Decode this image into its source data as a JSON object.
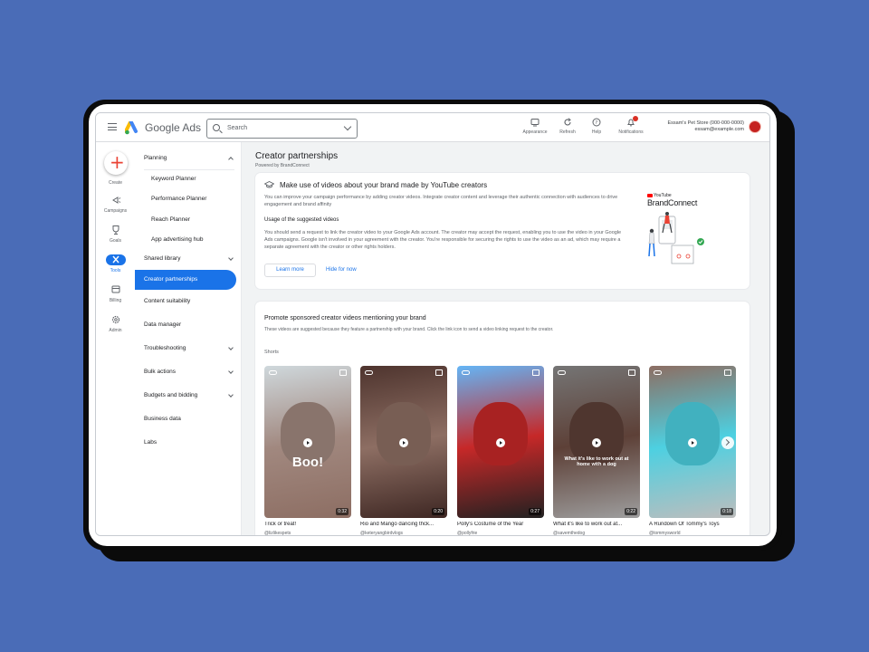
{
  "app": {
    "brand": "Google Ads",
    "search_placeholder": "Search",
    "accent_color": "#1a73e8",
    "background_color": "#4a6cb7"
  },
  "toolbar": {
    "actions": [
      {
        "label": "Appearance",
        "icon": "appearance-icon"
      },
      {
        "label": "Refresh",
        "icon": "refresh-icon"
      },
      {
        "label": "Help",
        "icon": "help-icon"
      },
      {
        "label": "Notifications",
        "icon": "bell-icon"
      }
    ],
    "account_name": "Essam's Pet Store (000-000-0000)",
    "account_email": "essam@example.com"
  },
  "rail": {
    "create_label": "Create",
    "items": [
      {
        "label": "Campaigns",
        "icon": "campaigns-icon"
      },
      {
        "label": "Goals",
        "icon": "trophy-icon"
      },
      {
        "label": "Tools",
        "icon": "tools-icon",
        "active": true
      },
      {
        "label": "Billing",
        "icon": "card-icon"
      },
      {
        "label": "Admin",
        "icon": "gear-icon"
      }
    ]
  },
  "nav": {
    "planning": "Planning",
    "keyword_planner": "Keyword Planner",
    "performance_planner": "Performance Planner",
    "reach_planner": "Reach Planner",
    "app_hub": "App advertising hub",
    "shared_library": "Shared library",
    "creator_partnerships": "Creator partnerships",
    "content_suitability": "Content suitability",
    "data_manager": "Data manager",
    "troubleshooting": "Troubleshooting",
    "bulk_actions": "Bulk actions",
    "budgets_bidding": "Budgets and bidding",
    "business_data": "Business data",
    "labs": "Labs"
  },
  "page": {
    "title": "Creator partnerships",
    "subtitle": "Powered by BrandConnect"
  },
  "intro_card": {
    "title": "Make use of videos about your brand made by YouTube creators",
    "body": "You can improve your campaign performance by adding creator videos. Integrate creator content and leverage their authentic connection with audiences to drive engagement and brand affinity",
    "usage_heading": "Usage of the suggested videos",
    "usage_body": "You should send a request to link the creator video to your Google Ads account. The creator may accept the request, enabling you to use the video in your Google Ads campaigns. Google isn't involved in your agreement with the creator. You're responsible for securing the rights to use the video as an ad, which may require a separate agreement with the creator or other rights holders.",
    "learn_more": "Learn more",
    "hide": "Hide for now",
    "logo_top": "YouTube",
    "logo_name": "BrandConnect"
  },
  "videos_card": {
    "title": "Promote sponsored creator videos mentioning your brand",
    "body": "These videos are suggested because they feature a partnership with your brand. Click the link icon to send a video linking request to the creator.",
    "section": "Shorts",
    "videos": [
      {
        "title": "Trick or treat!",
        "channel": "@lizlikespets",
        "duration": "0:32",
        "overlay": "Boo!",
        "colors": [
          "#cfd8dc",
          "#a1887f",
          "#8d6e63"
        ]
      },
      {
        "title": "Rio and Mango dancing thck...",
        "channel": "@keteryangbirdvlogs",
        "duration": "0:20",
        "overlay": "",
        "colors": [
          "#4e342e",
          "#8d6e63",
          "#3e2723"
        ]
      },
      {
        "title": "Polly's Costume of the Year",
        "channel": "@pollyfrie",
        "duration": "0:27",
        "overlay": "",
        "colors": [
          "#64b5f6",
          "#c62828",
          "#212121"
        ]
      },
      {
        "title": "What it's like to work out at...",
        "channel": "@savemthedog",
        "duration": "0:22",
        "overlay": "What it's like to work out at home with a dog",
        "colors": [
          "#757575",
          "#5d4037",
          "#9e9e9e"
        ]
      },
      {
        "title": "A Rundown Of Tommy's Toys",
        "channel": "@tommysworld",
        "duration": "0:18",
        "overlay": "",
        "colors": [
          "#8d6e63",
          "#4dd0e1",
          "#bdbdbd"
        ]
      }
    ]
  }
}
